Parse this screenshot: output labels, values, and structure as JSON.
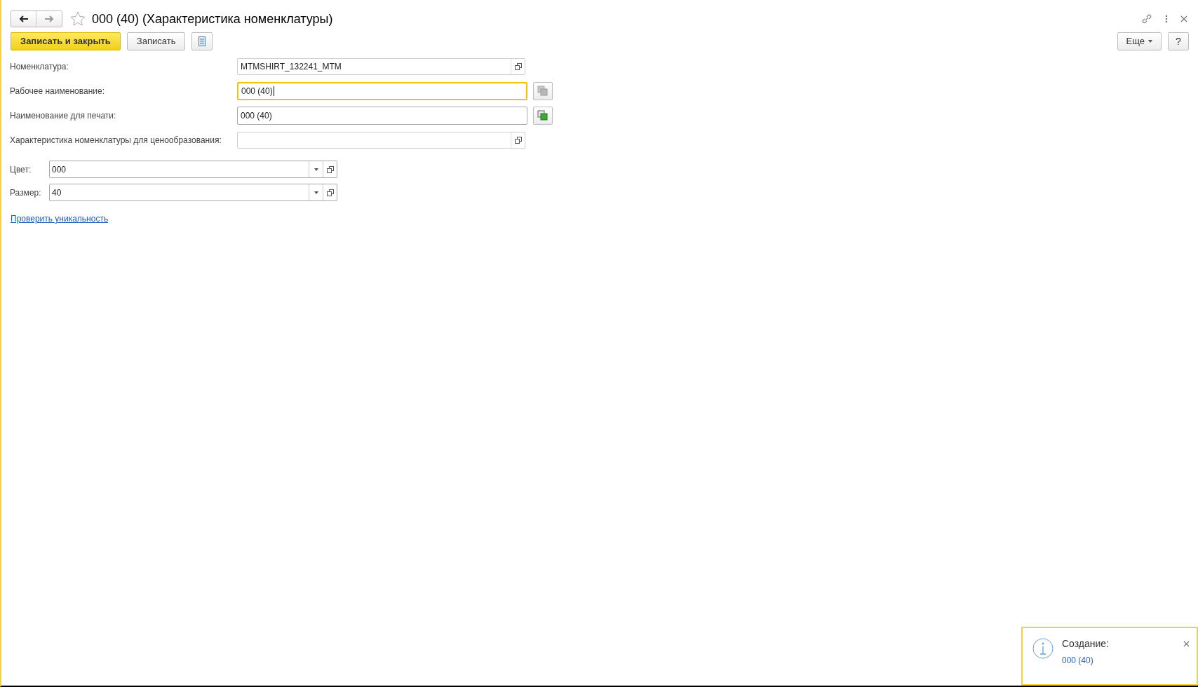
{
  "window": {
    "title": "000 (40) (Характеристика номенклатуры)",
    "favorite": false
  },
  "toolbar": {
    "primary": "Записать и закрыть",
    "secondary": "Записать",
    "more": "Еще",
    "help": "?"
  },
  "fields": [
    {
      "label": "Номенклатура:",
      "value": "MTMSHIRT_132241_MTM",
      "kind": "ref",
      "focused": false
    },
    {
      "label": "Рабочее наименование:",
      "value": "000 (40)",
      "kind": "copy",
      "focused": true,
      "disabled": true
    },
    {
      "label": "Наименование для печати:",
      "value": "000 (40)",
      "kind": "copy",
      "focused": false,
      "disabled": false
    },
    {
      "label": "Характеристика номенклатуры для ценообразования:",
      "kind": "ref",
      "focused": false
    }
  ],
  "properties": [
    {
      "label": "Цвет:",
      "value": "000"
    },
    {
      "label": "Размер:",
      "value": "40"
    }
  ],
  "link": "Проверить уникальность",
  "notification": {
    "title": "Создание:",
    "link": "000 (40)"
  }
}
